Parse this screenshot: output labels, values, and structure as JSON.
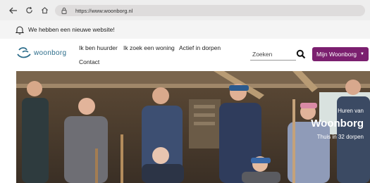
{
  "browser": {
    "url": "https://www.woonborg.nl",
    "icons": [
      "back-arrow-icon",
      "reload-icon",
      "home-icon",
      "lock-icon"
    ]
  },
  "notice": {
    "text": "We hebben een nieuwe website!",
    "icon": "bell-icon"
  },
  "header": {
    "logo_text": "woonborg",
    "menu": [
      {
        "label": "Ik ben huurder"
      },
      {
        "label": "Ik zoek een woning"
      },
      {
        "label": "Actief in dorpen"
      },
      {
        "label": "Contact"
      }
    ],
    "search": {
      "placeholder": "Zoeken",
      "icon": "search-icon"
    },
    "cta_label": "Mijn Woonborg"
  },
  "hero": {
    "subtitle": "Huren van",
    "title": "Woonborg",
    "tagline": "Thuis in 32 dorpen"
  },
  "colors": {
    "brand_purple": "#7b1f6f",
    "logo_blue": "#2b6c8a",
    "browser_bar": "#eeeeee",
    "notice_bar": "#f4f4f4"
  }
}
